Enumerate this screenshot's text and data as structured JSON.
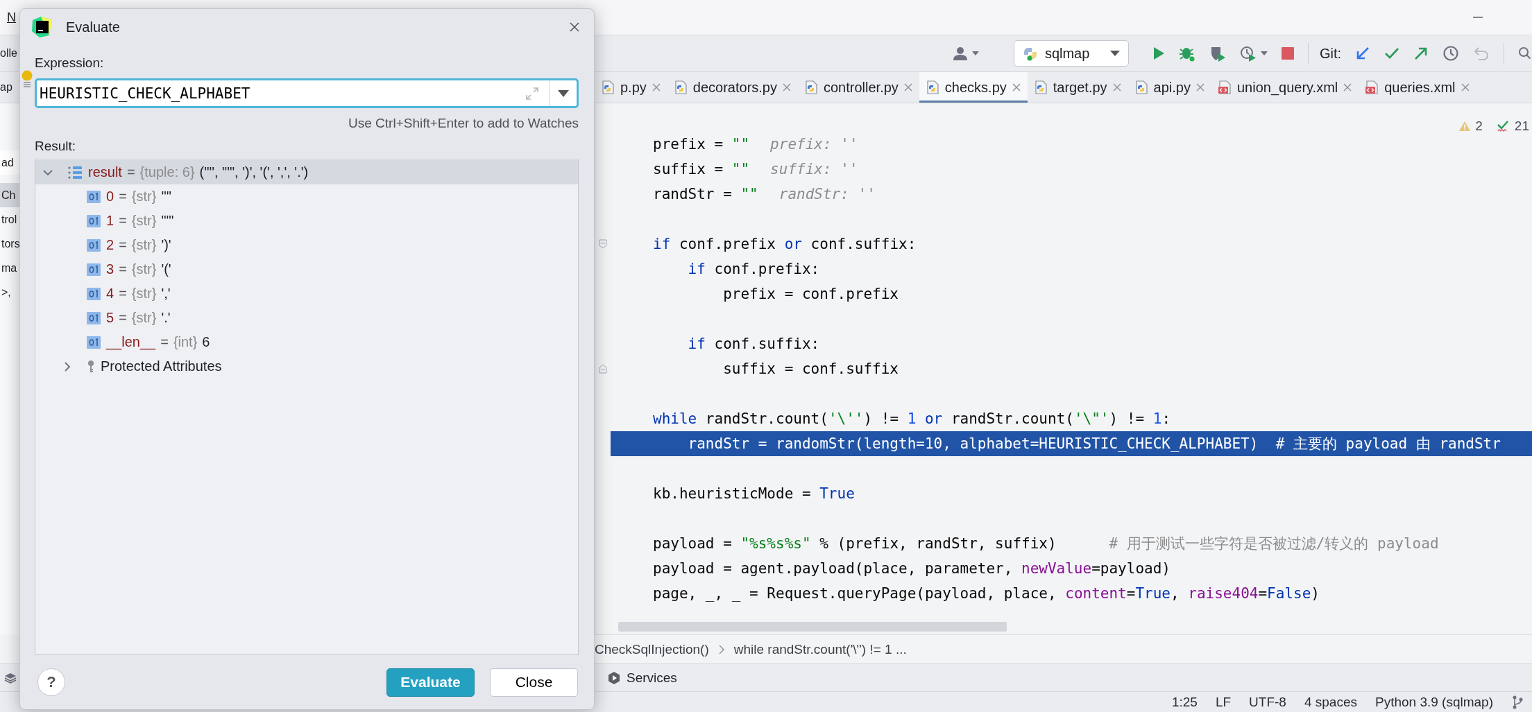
{
  "menu_bar": {
    "fragment": "N"
  },
  "toolbar": {
    "fragment": "olle",
    "account": {
      "kind": "user",
      "dropdown": true
    },
    "run_config": "sqlmap",
    "run_actions": [
      {
        "kind": "run",
        "disabled": false
      },
      {
        "kind": "debug",
        "disabled": false
      },
      {
        "kind": "coverage",
        "disabled": false
      },
      {
        "kind": "profile",
        "dropdown": true,
        "disabled": false
      },
      {
        "kind": "stop",
        "disabled": false
      }
    ],
    "git_label": "Git:",
    "git_actions": [
      {
        "kind": "update",
        "disabled": false
      },
      {
        "kind": "commit",
        "disabled": false
      },
      {
        "kind": "push",
        "disabled": false
      },
      {
        "kind": "history",
        "disabled": false
      },
      {
        "kind": "rollback",
        "disabled": true
      }
    ]
  },
  "editor_tabs": {
    "fragment": "ap",
    "tabs": [
      {
        "label": "p.py",
        "kind": "python",
        "selected": false
      },
      {
        "label": "decorators.py",
        "kind": "python",
        "selected": false
      },
      {
        "label": "controller.py",
        "kind": "python",
        "selected": false
      },
      {
        "label": "checks.py",
        "kind": "python",
        "selected": true
      },
      {
        "label": "target.py",
        "kind": "python",
        "selected": false
      },
      {
        "label": "api.py",
        "kind": "python",
        "selected": false
      },
      {
        "label": "union_query.xml",
        "kind": "xml",
        "selected": false
      },
      {
        "label": "queries.xml",
        "kind": "xml",
        "selected": false
      }
    ]
  },
  "project_panel": {
    "items": [
      {
        "label": "ad",
        "selected": false
      },
      {
        "label": "Ch",
        "selected": true
      },
      {
        "label": "trol",
        "selected": false
      },
      {
        "label": "tors",
        "selected": false
      },
      {
        "label": "ma",
        "selected": false
      },
      {
        "label": ">,",
        "selected": false
      }
    ]
  },
  "editor": {
    "inspections": {
      "warnings": "2",
      "checks": "21"
    },
    "lines": [
      {
        "kind": "code",
        "highlighted": false,
        "tokens": [
          {
            "text": "prefix = ",
            "kind": "plain"
          },
          {
            "text": "\"\"",
            "kind": "string"
          },
          {
            "text": "prefix: ''",
            "kind": "hint"
          }
        ]
      },
      {
        "kind": "code",
        "highlighted": false,
        "tokens": [
          {
            "text": "suffix = ",
            "kind": "plain"
          },
          {
            "text": "\"\"",
            "kind": "string"
          },
          {
            "text": "suffix: ''",
            "kind": "hint"
          }
        ]
      },
      {
        "kind": "code",
        "highlighted": false,
        "tokens": [
          {
            "text": "randStr = ",
            "kind": "plain"
          },
          {
            "text": "\"\"",
            "kind": "string"
          },
          {
            "text": "randStr: ''",
            "kind": "hint"
          }
        ]
      },
      {
        "kind": "blank",
        "highlighted": false
      },
      {
        "kind": "code",
        "highlighted": false,
        "fold_start": true,
        "tokens": [
          {
            "text": "if",
            "kind": "keyword"
          },
          {
            "text": " conf.prefix ",
            "kind": "plain"
          },
          {
            "text": "or",
            "kind": "keyword"
          },
          {
            "text": " conf.suffix:",
            "kind": "plain"
          }
        ]
      },
      {
        "kind": "code",
        "highlighted": false,
        "tokens": [
          {
            "text": "    if",
            "kind": "keyword"
          },
          {
            "text": " conf.prefix:",
            "kind": "plain"
          }
        ]
      },
      {
        "kind": "code",
        "highlighted": false,
        "tokens": [
          {
            "text": "        prefix = conf.prefix",
            "kind": "plain"
          }
        ]
      },
      {
        "kind": "blank",
        "highlighted": false
      },
      {
        "kind": "code",
        "highlighted": false,
        "tokens": [
          {
            "text": "    if",
            "kind": "keyword"
          },
          {
            "text": " conf.suffix:",
            "kind": "plain"
          }
        ]
      },
      {
        "kind": "code",
        "highlighted": false,
        "fold_end": true,
        "tokens": [
          {
            "text": "        suffix = conf.suffix",
            "kind": "plain"
          }
        ]
      },
      {
        "kind": "blank",
        "highlighted": false
      },
      {
        "kind": "code",
        "highlighted": false,
        "tokens": [
          {
            "text": "while",
            "kind": "keyword"
          },
          {
            "text": " randStr.count(",
            "kind": "plain"
          },
          {
            "text": "'\\''",
            "kind": "string"
          },
          {
            "text": ") != ",
            "kind": "plain"
          },
          {
            "text": "1",
            "kind": "number"
          },
          {
            "text": " or",
            "kind": "keyword"
          },
          {
            "text": " randStr.count(",
            "kind": "plain"
          },
          {
            "text": "'\\\"'",
            "kind": "string"
          },
          {
            "text": ") != ",
            "kind": "plain"
          },
          {
            "text": "1",
            "kind": "number"
          },
          {
            "text": ":",
            "kind": "plain"
          }
        ]
      },
      {
        "kind": "code",
        "highlighted": true,
        "tokens": [
          {
            "text": "    randStr = randomStr(length=10, alphabet=HEURISTIC_CHECK_ALPHABET)  ",
            "kind": "plain"
          },
          {
            "text": "# 主要的 payload 由 randStr",
            "kind": "comment"
          }
        ]
      },
      {
        "kind": "blank",
        "highlighted": false
      },
      {
        "kind": "code",
        "highlighted": false,
        "tokens": [
          {
            "text": "kb.heuristicMode = ",
            "kind": "plain"
          },
          {
            "text": "True",
            "kind": "keyword"
          }
        ]
      },
      {
        "kind": "blank",
        "highlighted": false
      },
      {
        "kind": "code",
        "highlighted": false,
        "tokens": [
          {
            "text": "payload = ",
            "kind": "plain"
          },
          {
            "text": "\"%s%s%s\"",
            "kind": "string"
          },
          {
            "text": " % (prefix, randStr, suffix)      ",
            "kind": "plain"
          },
          {
            "text": "# 用于测试一些字符是否被过滤/转义的 payload",
            "kind": "comment"
          }
        ]
      },
      {
        "kind": "code",
        "highlighted": false,
        "tokens": [
          {
            "text": "payload = agent.payload(place, parameter, ",
            "kind": "plain"
          },
          {
            "text": "newValue",
            "kind": "param"
          },
          {
            "text": "=payload)",
            "kind": "plain"
          }
        ]
      },
      {
        "kind": "code",
        "highlighted": false,
        "tokens": [
          {
            "text": "page, _, _ = Request.queryPage(payload, place, ",
            "kind": "plain"
          },
          {
            "text": "content",
            "kind": "param"
          },
          {
            "text": "=",
            "kind": "plain"
          },
          {
            "text": "True",
            "kind": "keyword"
          },
          {
            "text": ", ",
            "kind": "plain"
          },
          {
            "text": "raise404",
            "kind": "param"
          },
          {
            "text": "=",
            "kind": "plain"
          },
          {
            "text": "False",
            "kind": "keyword"
          },
          {
            "text": ")",
            "kind": "plain"
          }
        ]
      }
    ]
  },
  "breadcrumbs": [
    {
      "label": "CheckSqlInjection()"
    },
    {
      "label": "while randStr.count('\\'') != 1 ..."
    }
  ],
  "tool_windows": [
    {
      "label": "Services"
    }
  ],
  "status_bar": {
    "items": [
      "1:25",
      "LF",
      "UTF-8",
      "4 spaces",
      "Python 3.9 (sqlmap)"
    ]
  },
  "dialog": {
    "title": "Evaluate",
    "expression_label": "Expression:",
    "expression": "HEURISTIC_CHECK_ALPHABET",
    "hint": "Use Ctrl+Shift+Enter to add to Watches",
    "result_label": "Result:",
    "result": {
      "tree": [
        {
          "name": "result",
          "op": "=",
          "type": "{tuple: 6}",
          "value": "('\"', \"'\", ')', '(', ',', '.')",
          "kind": "list",
          "expanded": true,
          "selected": true,
          "children": [
            {
              "name": "0",
              "op": "=",
              "type": "{str}",
              "value": "'\"'",
              "kind": "variable",
              "selected": false
            },
            {
              "name": "1",
              "op": "=",
              "type": "{str}",
              "value": "\"'\"",
              "kind": "variable",
              "selected": false
            },
            {
              "name": "2",
              "op": "=",
              "type": "{str}",
              "value": "')'",
              "kind": "variable",
              "selected": false
            },
            {
              "name": "3",
              "op": "=",
              "type": "{str}",
              "value": "'('",
              "kind": "variable",
              "selected": false
            },
            {
              "name": "4",
              "op": "=",
              "type": "{str}",
              "value": "','",
              "kind": "variable",
              "selected": false
            },
            {
              "name": "5",
              "op": "=",
              "type": "{str}",
              "value": "'.'",
              "kind": "variable",
              "selected": false
            },
            {
              "name": "__len__",
              "op": "=",
              "type": "{int}",
              "value": "6",
              "kind": "variable",
              "selected": false
            },
            {
              "name": "Protected Attributes",
              "kind": "group",
              "expanded": false,
              "selected": false
            }
          ]
        }
      ]
    },
    "help_label": "?",
    "buttons": [
      {
        "label": "Evaluate",
        "kind": "primary"
      },
      {
        "label": "Close",
        "kind": "secondary"
      }
    ]
  }
}
